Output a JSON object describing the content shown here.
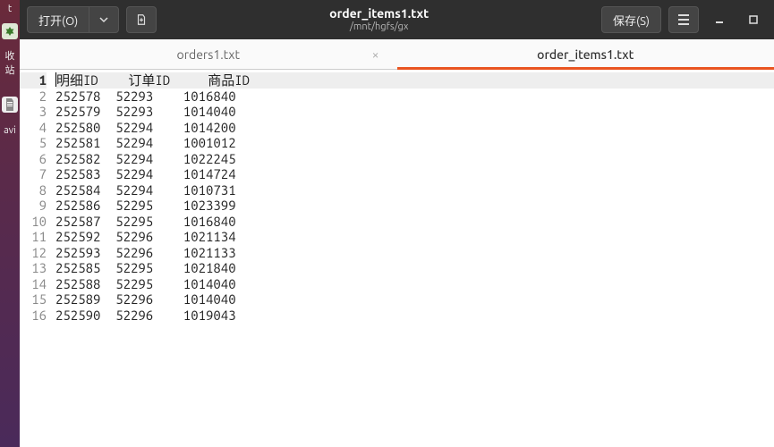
{
  "desktop": {
    "frag_top": "t",
    "recycle_label": "收站",
    "navi_label": "avi"
  },
  "titlebar": {
    "open_label": "打开(O)",
    "title": "order_items1.txt",
    "subtitle": "/mnt/hgfs/gx",
    "save_label": "保存(S)"
  },
  "tabs": [
    {
      "label": "orders1.txt",
      "active": false,
      "closeable": true
    },
    {
      "label": "order_items1.txt",
      "active": true,
      "closeable": false
    }
  ],
  "table": {
    "headers": [
      "明细ID",
      "订单ID",
      "商品ID"
    ],
    "rows": [
      [
        "252578",
        "52293",
        "1016840"
      ],
      [
        "252579",
        "52293",
        "1014040"
      ],
      [
        "252580",
        "52294",
        "1014200"
      ],
      [
        "252581",
        "52294",
        "1001012"
      ],
      [
        "252582",
        "52294",
        "1022245"
      ],
      [
        "252583",
        "52294",
        "1014724"
      ],
      [
        "252584",
        "52294",
        "1010731"
      ],
      [
        "252586",
        "52295",
        "1023399"
      ],
      [
        "252587",
        "52295",
        "1016840"
      ],
      [
        "252592",
        "52296",
        "1021134"
      ],
      [
        "252593",
        "52296",
        "1021133"
      ],
      [
        "252585",
        "52295",
        "1021840"
      ],
      [
        "252588",
        "52295",
        "1014040"
      ],
      [
        "252589",
        "52296",
        "1014040"
      ],
      [
        "252590",
        "52296",
        "1019043"
      ]
    ]
  }
}
